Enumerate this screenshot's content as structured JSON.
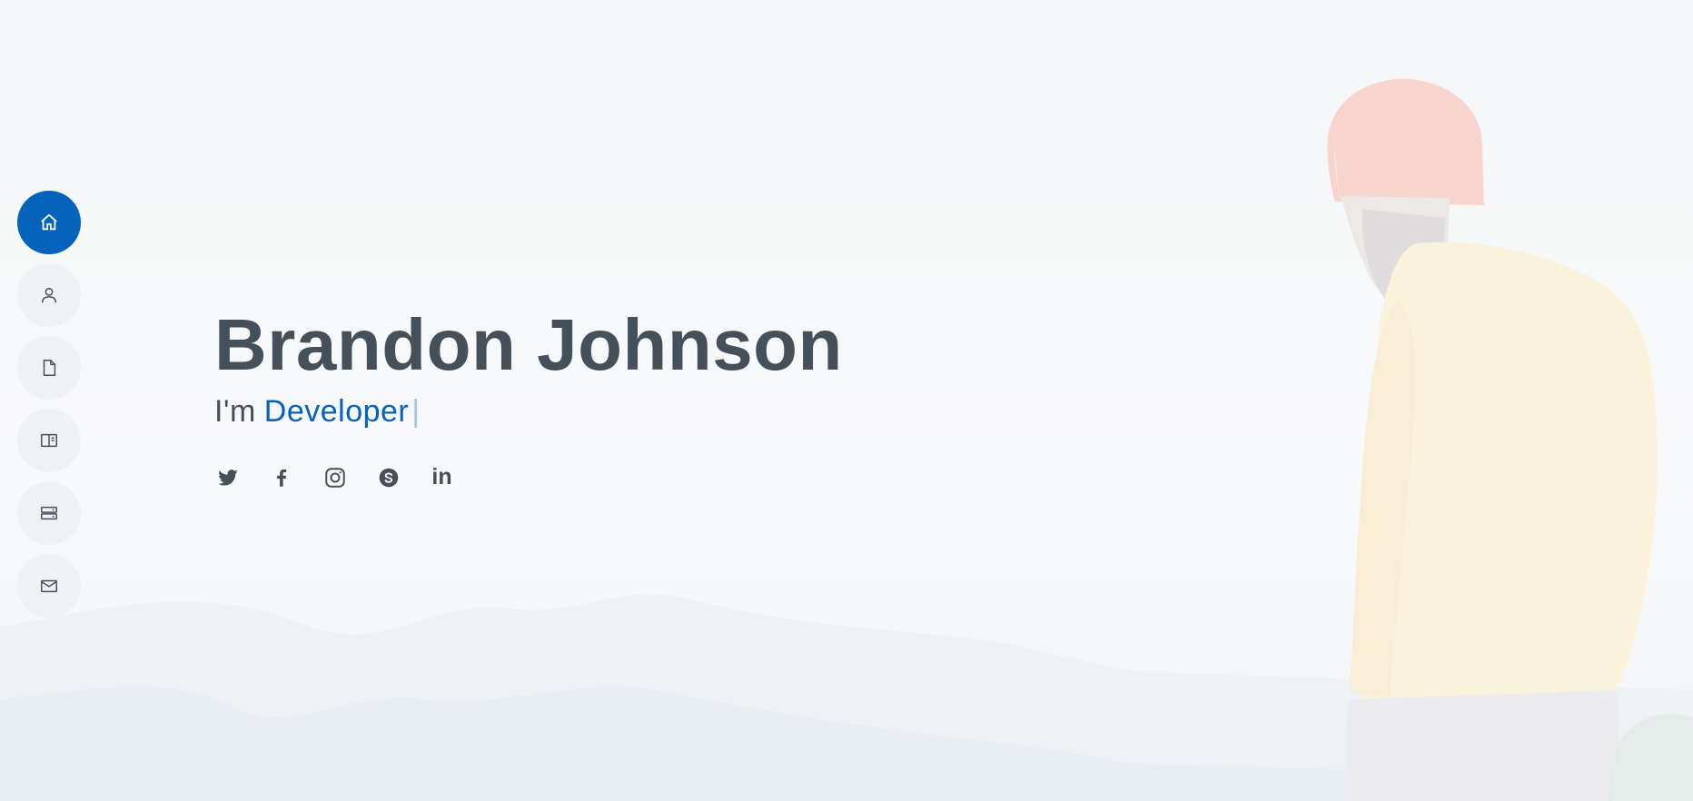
{
  "hero": {
    "name": "Brandon Johnson",
    "prefix": "I'm",
    "role": "Developer",
    "cursor": "|"
  },
  "nav": [
    {
      "id": "home",
      "icon": "home-icon",
      "active": true
    },
    {
      "id": "about",
      "icon": "person-icon",
      "active": false
    },
    {
      "id": "resume",
      "icon": "file-icon",
      "active": false
    },
    {
      "id": "portfolio",
      "icon": "book-half-icon",
      "active": false
    },
    {
      "id": "services",
      "icon": "server-icon",
      "active": false
    },
    {
      "id": "contact",
      "icon": "envelope-icon",
      "active": false
    }
  ],
  "social": [
    {
      "id": "twitter",
      "icon": "twitter-icon"
    },
    {
      "id": "facebook",
      "icon": "facebook-icon"
    },
    {
      "id": "instagram",
      "icon": "instagram-icon"
    },
    {
      "id": "skype",
      "icon": "skype-icon"
    },
    {
      "id": "linkedin",
      "icon": "linkedin-icon",
      "text": "in"
    }
  ],
  "colors": {
    "accent": "#0563bb",
    "text": "#45505b",
    "nav_bg": "#eff1f3"
  }
}
